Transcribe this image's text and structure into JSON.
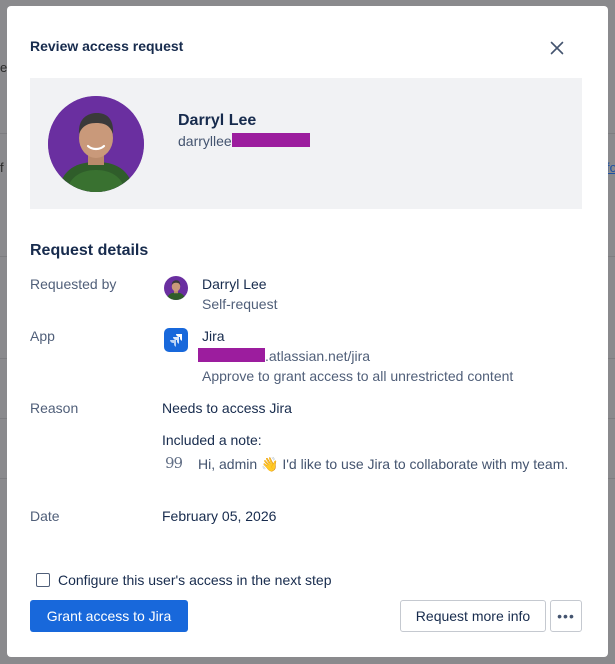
{
  "modal": {
    "title": "Review access request",
    "profile": {
      "name": "Darryl Lee",
      "handle_prefix": "darryllee"
    },
    "section_title": "Request details",
    "requested_by": {
      "label": "Requested by",
      "name": "Darryl Lee",
      "type": "Self-request"
    },
    "app": {
      "label": "App",
      "name": "Jira",
      "url_suffix": ".atlassian.net/jira",
      "description": "Approve to grant access to all unrestricted content"
    },
    "reason": {
      "label": "Reason",
      "text": "Needs to access Jira",
      "note_label": "Included a note:",
      "note_before_emoji": "Hi, admin ",
      "note_emoji": "👋",
      "note_after_emoji": " I'd like to use Jira to collaborate with my team."
    },
    "date": {
      "label": "Date",
      "value": "February 05, 2026"
    },
    "checkbox_label": "Configure this user's access in the next step",
    "buttons": {
      "grant": "Grant access to Jira",
      "request_info": "Request more info",
      "more": "•••"
    }
  },
  "colors": {
    "primary": "#1868db",
    "redaction": "#9c1d9e",
    "panel_bg": "#f1f2f4"
  }
}
